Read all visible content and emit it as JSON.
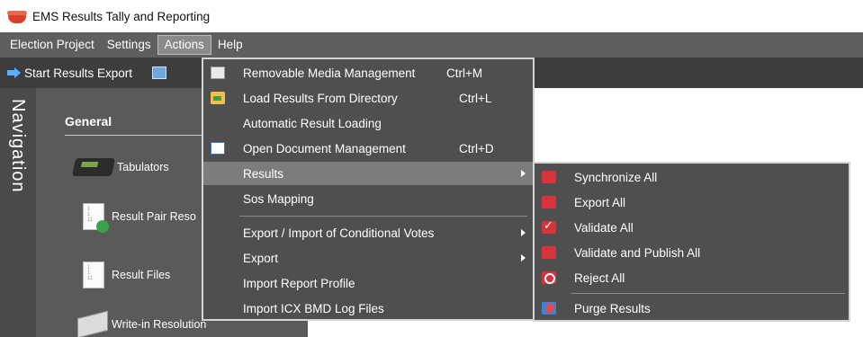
{
  "window": {
    "title": "EMS Results Tally and Reporting",
    "icon": "app-logo-icon"
  },
  "menubar": {
    "items": [
      {
        "label": "Election Project"
      },
      {
        "label": "Settings"
      },
      {
        "label": "Actions",
        "active": true
      },
      {
        "label": "Help"
      }
    ]
  },
  "toolbar": {
    "start_export_label": "Start Results Export"
  },
  "navigation": {
    "title": "Navigation",
    "section": "General",
    "items": [
      {
        "label": "Tabulators",
        "icon": "tabulator-icon"
      },
      {
        "label": "Result Pair Reso",
        "icon": "result-pair-icon"
      },
      {
        "label": "Result Files",
        "icon": "result-files-icon"
      },
      {
        "label": "Write-in Resolution",
        "icon": "write-in-icon"
      }
    ]
  },
  "actions_menu": {
    "items": [
      {
        "label": "Removable Media Management",
        "shortcut": "Ctrl+M",
        "icon": "removable-media-icon"
      },
      {
        "label": "Load Results From Directory",
        "shortcut": "Ctrl+L",
        "icon": "folder-icon"
      },
      {
        "label": "Automatic Result Loading",
        "shortcut": ""
      },
      {
        "label": "Open Document Management",
        "shortcut": "Ctrl+D",
        "icon": "document-icon"
      },
      {
        "label": "Results",
        "submenu": true,
        "highlighted": true
      },
      {
        "label": "Sos Mapping"
      },
      {
        "label": "Export / Import of Conditional Votes",
        "submenu": true
      },
      {
        "label": "Export",
        "submenu": true
      },
      {
        "label": "Import Report Profile"
      },
      {
        "label": "Import ICX BMD Log Files"
      }
    ]
  },
  "results_submenu": {
    "items": [
      {
        "label": "Synchronize All",
        "icon": "synchronize-icon"
      },
      {
        "label": "Export All",
        "icon": "export-icon"
      },
      {
        "label": "Validate All",
        "icon": "validate-icon"
      },
      {
        "label": "Validate and Publish All",
        "icon": "publish-icon"
      },
      {
        "label": "Reject All",
        "icon": "reject-icon"
      },
      {
        "label": "Purge Results",
        "icon": "purge-icon"
      }
    ]
  },
  "colors": {
    "menubar": "#5f5f5f",
    "toolbar": "#3d3d3d",
    "menu_bg": "#4f4f4f",
    "highlight": "#7c7c7c",
    "accent_red": "#d6343a"
  }
}
